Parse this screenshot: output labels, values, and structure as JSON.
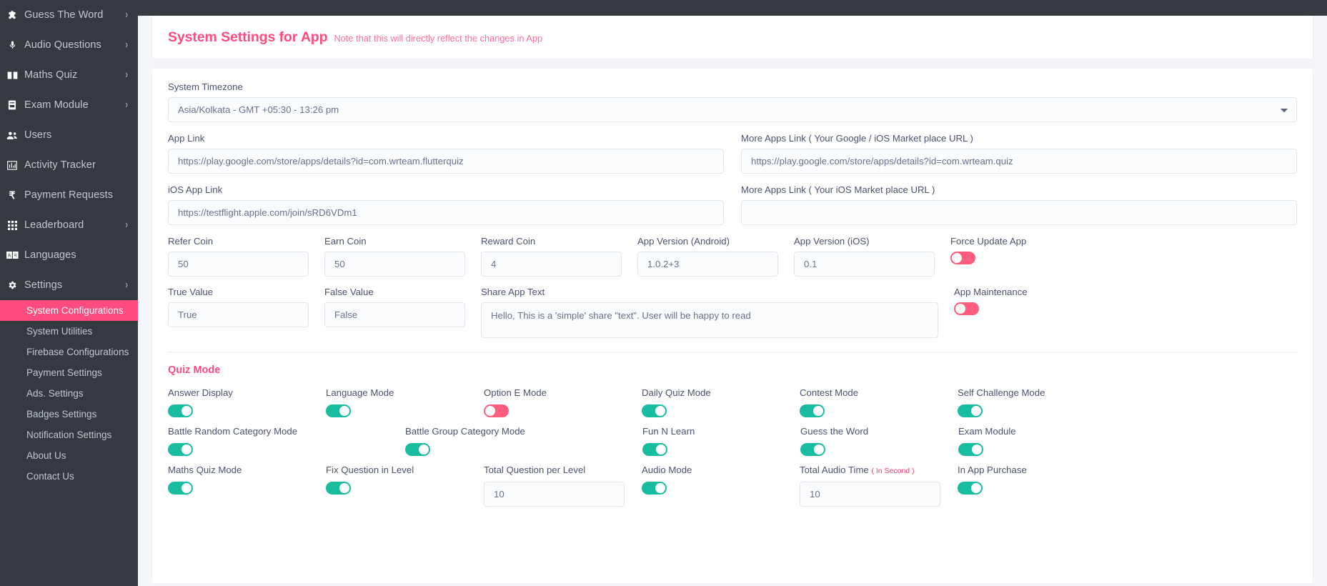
{
  "sidebar": {
    "items": [
      {
        "label": "Guess The Word",
        "icon": "puzzle-icon",
        "chevron": "›"
      },
      {
        "label": "Audio Questions",
        "icon": "microphone-icon",
        "chevron": "›"
      },
      {
        "label": "Maths Quiz",
        "icon": "book-icon",
        "chevron": "›"
      },
      {
        "label": "Exam Module",
        "icon": "clipboard-icon",
        "chevron": "›"
      },
      {
        "label": "Users",
        "icon": "users-icon",
        "chevron": ""
      },
      {
        "label": "Activity Tracker",
        "icon": "chart-icon",
        "chevron": ""
      },
      {
        "label": "Payment Requests",
        "icon": "rupee-icon",
        "chevron": ""
      },
      {
        "label": "Leaderboard",
        "icon": "grid-icon",
        "chevron": "›"
      },
      {
        "label": "Languages",
        "icon": "language-icon",
        "chevron": ""
      },
      {
        "label": "Settings",
        "icon": "gear-icon",
        "chevron": "›"
      }
    ],
    "subitems": [
      {
        "label": "System Configurations",
        "active": true
      },
      {
        "label": "System Utilities",
        "active": false
      },
      {
        "label": "Firebase Configurations",
        "active": false
      },
      {
        "label": "Payment Settings",
        "active": false
      },
      {
        "label": "Ads. Settings",
        "active": false
      },
      {
        "label": "Badges Settings",
        "active": false
      },
      {
        "label": "Notification Settings",
        "active": false
      },
      {
        "label": "About Us",
        "active": false
      },
      {
        "label": "Contact Us",
        "active": false
      }
    ]
  },
  "header": {
    "title": "System Settings for App",
    "note": "Note that this will directly reflect the changes in App"
  },
  "form": {
    "timezone_label": "System Timezone",
    "timezone_value": "Asia/Kolkata - GMT +05:30 - 13:26 pm",
    "app_link_label": "App Link",
    "app_link_value": "https://play.google.com/store/apps/details?id=com.wrteam.flutterquiz",
    "more_apps_google_label": "More Apps Link ( Your Google / iOS Market place URL )",
    "more_apps_google_value": "https://play.google.com/store/apps/details?id=com.wrteam.quiz",
    "ios_app_link_label": "iOS App Link",
    "ios_app_link_value": "https://testflight.apple.com/join/sRD6VDm1",
    "more_apps_ios_label": "More Apps Link ( Your iOS Market place URL )",
    "more_apps_ios_value": "",
    "refer_coin_label": "Refer Coin",
    "refer_coin_value": "50",
    "earn_coin_label": "Earn Coin",
    "earn_coin_value": "50",
    "reward_coin_label": "Reward Coin",
    "reward_coin_value": "4",
    "app_version_android_label": "App Version (Android)",
    "app_version_android_value": "1.0.2+3",
    "app_version_ios_label": "App Version (iOS)",
    "app_version_ios_value": "0.1",
    "force_update_label": "Force Update App",
    "force_update_on": false,
    "true_value_label": "True Value",
    "true_value_value": "True",
    "false_value_label": "False Value",
    "false_value_value": "False",
    "share_app_text_label": "Share App Text",
    "share_app_text_value": "Hello, This is a 'simple' share \"text\". User will be happy to read",
    "app_maintenance_label": "App Maintenance",
    "app_maintenance_on": false
  },
  "quiz_mode": {
    "title": "Quiz Mode",
    "rows": [
      [
        {
          "label": "Answer Display",
          "type": "toggle",
          "on": true
        },
        {
          "label": "Language Mode",
          "type": "toggle",
          "on": true
        },
        {
          "label": "Option E Mode",
          "type": "toggle",
          "on": false
        },
        {
          "label": "Daily Quiz Mode",
          "type": "toggle",
          "on": true
        },
        {
          "label": "Contest Mode",
          "type": "toggle",
          "on": true
        },
        {
          "label": "Self Challenge Mode",
          "type": "toggle",
          "on": true
        }
      ],
      [
        {
          "label": "Battle Random Category Mode",
          "type": "toggle",
          "on": true
        },
        {
          "label": "Battle Group Category Mode",
          "type": "toggle",
          "on": true
        },
        {
          "label": "Fun N Learn",
          "type": "toggle",
          "on": true
        },
        {
          "label": "Guess the Word",
          "type": "toggle",
          "on": true
        },
        {
          "label": "Exam Module",
          "type": "toggle",
          "on": true
        }
      ],
      [
        {
          "label": "Maths Quiz Mode",
          "type": "toggle",
          "on": true
        },
        {
          "label": "Fix Question in Level",
          "type": "toggle",
          "on": true
        },
        {
          "label": "Total Question per Level",
          "type": "input",
          "value": "10"
        },
        {
          "label": "Audio Mode",
          "type": "toggle",
          "on": true
        },
        {
          "label": "Total Audio Time",
          "sub": "( In Second )",
          "type": "input",
          "value": "10"
        },
        {
          "label": "In App Purchase",
          "type": "toggle",
          "on": true
        }
      ]
    ]
  },
  "colors": {
    "accent": "#ff4b7d",
    "sidebar_bg": "#343a40",
    "toggle_on": "#18bda0",
    "toggle_off": "#fc5c7d",
    "page_bg": "#f4f6f9"
  }
}
